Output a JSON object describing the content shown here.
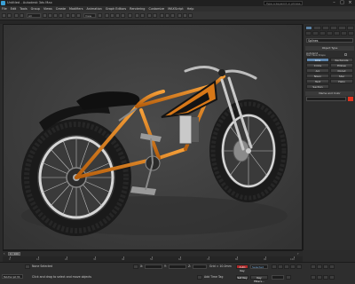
{
  "window": {
    "title": "Untitled - Autodesk 3ds Max",
    "search_placeholder": "Type a keyword or phrase"
  },
  "menu": [
    "File",
    "Edit",
    "Tools",
    "Group",
    "Views",
    "Create",
    "Modifiers",
    "Animation",
    "Graph Editors",
    "Rendering",
    "Customize",
    "MAXScript",
    "Help"
  ],
  "toolbar": {
    "selection_filter": "All",
    "view_dropdown": "View"
  },
  "viewport": {
    "label": "Perspective"
  },
  "command_panel": {
    "category_dropdown": "Splines",
    "object_type_header": "Object Type",
    "autogrid": "AutoGrid",
    "start_new_shape": "Start New Shape",
    "buttons": [
      "Line",
      "Rectangle",
      "Circle",
      "Ellipse",
      "Arc",
      "Donut",
      "NGon",
      "Star",
      "Text",
      "Helix",
      "Section"
    ],
    "name_color_header": "Name and Color",
    "swatch_color": "#e0341f"
  },
  "timeline": {
    "frame_display": "0 / 100",
    "ruler_ticks": [
      "0",
      "10",
      "20",
      "30",
      "40",
      "50",
      "60",
      "70",
      "80",
      "90",
      "100"
    ]
  },
  "status": {
    "maxscript_label": "MAXScript Mi",
    "selection": "None Selected",
    "prompt": "Click and drag to select and move objects",
    "x_label": "X:",
    "y_label": "Y:",
    "z_label": "Z:",
    "grid": "Grid = 10.0mm",
    "add_time_tag": "Add Time Tag",
    "auto_key": "Auto Key",
    "set_key": "Set Key",
    "key_filters": "Key Filters...",
    "selected": "Selected"
  },
  "colors": {
    "frame": "#d87818",
    "frame_highlight": "#f7a13a",
    "tire": "#1e1e1e",
    "rim": "#bdbdbd",
    "viewport_bg": "#3d3d3d"
  }
}
